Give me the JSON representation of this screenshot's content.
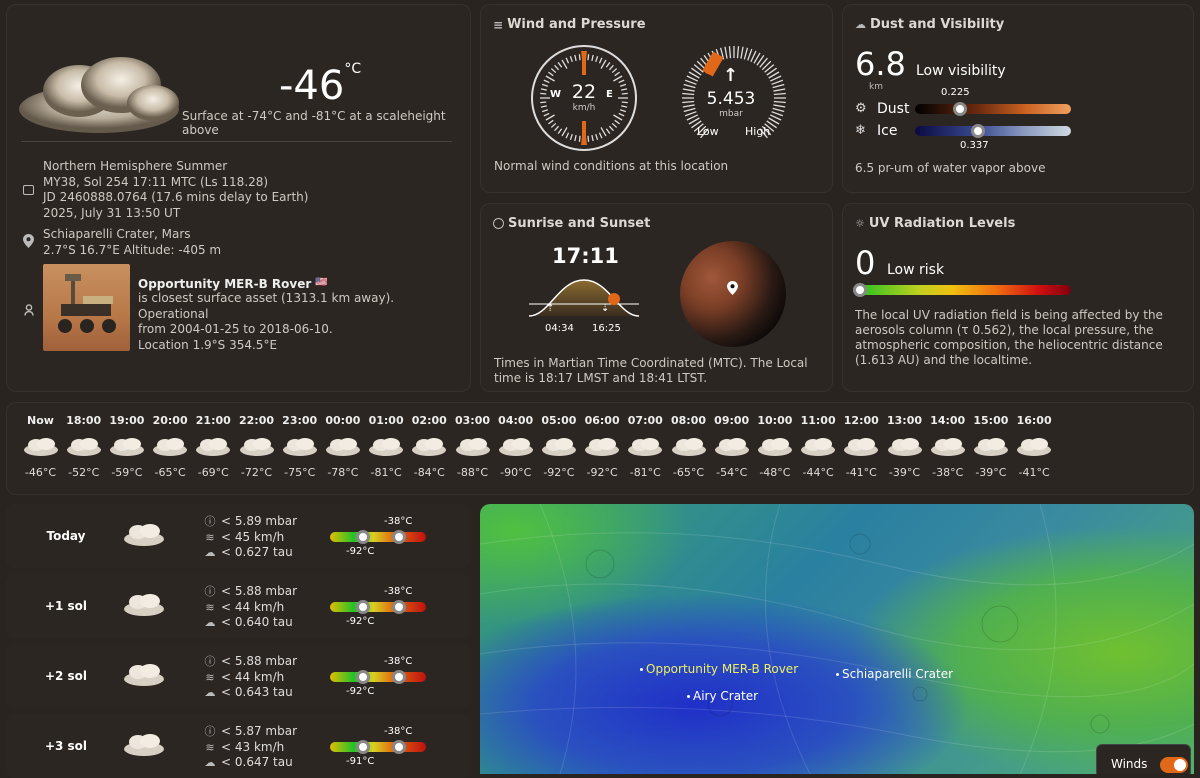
{
  "current": {
    "temp": "-46",
    "unit": "°C",
    "surface": "Surface at -74°C and -81°C at a scaleheight above",
    "date_lines": [
      "Northern Hemisphere Summer",
      "MY38, Sol 254 17:11 MTC (Ls 118.28)",
      "JD 2460888.0764 (17.6 mins delay to Earth)",
      "2025, July 31 13:50 UT"
    ],
    "location_lines": [
      "Schiaparelli Crater, Mars",
      "2.7°S 16.7°E Altitude: -405 m"
    ],
    "rover_name": "Opportunity MER-B Rover",
    "rover_flag": "🇺🇸",
    "rover_lines": [
      "is closest surface asset (1313.1 km away). Operational",
      "from 2004-01-25 to 2018-06-10.",
      "Location 1.9°S 354.5°E"
    ]
  },
  "wind": {
    "title": "Wind and Pressure",
    "speed": "22",
    "speed_unit": "km/h",
    "dirs": {
      "w": "W",
      "e": "E"
    },
    "pressure": "5.453",
    "pressure_unit": "mbar",
    "low": "Low",
    "high": "High",
    "note": "Normal wind conditions at this location"
  },
  "dust": {
    "title": "Dust and Visibility",
    "visibility": "6.8",
    "vis_unit": "km",
    "vis_label": "Low visibility",
    "dust_label": "Dust",
    "dust_value": "0.225",
    "dust_level": 0.225,
    "ice_label": "Ice",
    "ice_value": "0.337",
    "ice_level": 0.337,
    "note": "6.5 pr-um of water vapor above"
  },
  "sun": {
    "title": "Sunrise and Sunset",
    "time": "17:11",
    "sunrise": "04:34",
    "sunset": "16:25",
    "note": "Times in Martian Time Coordinated (MTC). The Local time is 18:17 LMST and 18:41 LTST."
  },
  "uv": {
    "title": "UV Radiation Levels",
    "value": "0",
    "label": "Low risk",
    "level": 0,
    "note": "The local UV radiation field is being affected by the aerosols column (τ 0.562), the local pressure, the atmospheric composition, the heliocentric distance (1.613 AU) and the localtime."
  },
  "hourly": [
    {
      "t": "Now",
      "v": "-46°C"
    },
    {
      "t": "18:00",
      "v": "-52°C"
    },
    {
      "t": "19:00",
      "v": "-59°C"
    },
    {
      "t": "20:00",
      "v": "-65°C"
    },
    {
      "t": "21:00",
      "v": "-69°C"
    },
    {
      "t": "22:00",
      "v": "-72°C"
    },
    {
      "t": "23:00",
      "v": "-75°C"
    },
    {
      "t": "00:00",
      "v": "-78°C"
    },
    {
      "t": "01:00",
      "v": "-81°C"
    },
    {
      "t": "02:00",
      "v": "-84°C"
    },
    {
      "t": "03:00",
      "v": "-88°C"
    },
    {
      "t": "04:00",
      "v": "-90°C"
    },
    {
      "t": "05:00",
      "v": "-92°C"
    },
    {
      "t": "06:00",
      "v": "-92°C"
    },
    {
      "t": "07:00",
      "v": "-81°C"
    },
    {
      "t": "08:00",
      "v": "-65°C"
    },
    {
      "t": "09:00",
      "v": "-54°C"
    },
    {
      "t": "10:00",
      "v": "-48°C"
    },
    {
      "t": "11:00",
      "v": "-44°C"
    },
    {
      "t": "12:00",
      "v": "-41°C"
    },
    {
      "t": "13:00",
      "v": "-39°C"
    },
    {
      "t": "14:00",
      "v": "-38°C"
    },
    {
      "t": "15:00",
      "v": "-39°C"
    },
    {
      "t": "16:00",
      "v": "-41°C"
    }
  ],
  "forecast": [
    {
      "label": "Today",
      "p": "< 5.89 mbar",
      "w": "< 45 km/h",
      "d": "< 0.627 tau",
      "hi": "-38°C",
      "lo": "-92°C"
    },
    {
      "label": "+1 sol",
      "p": "< 5.88 mbar",
      "w": "< 44 km/h",
      "d": "< 0.640 tau",
      "hi": "-38°C",
      "lo": "-92°C"
    },
    {
      "label": "+2 sol",
      "p": "< 5.88 mbar",
      "w": "< 44 km/h",
      "d": "< 0.643 tau",
      "hi": "-38°C",
      "lo": "-92°C"
    },
    {
      "label": "+3 sol",
      "p": "< 5.87 mbar",
      "w": "< 43 km/h",
      "d": "< 0.647 tau",
      "hi": "-38°C",
      "lo": "-91°C"
    }
  ],
  "map": {
    "labels": {
      "opportunity": "Opportunity MER-B Rover",
      "airy": "Airy Crater",
      "schiaparelli": "Schiaparelli Crater"
    },
    "toggle": "Winds",
    "toggle_on": true
  },
  "colors": {
    "accent": "#e06818",
    "card": "#2c2622",
    "text": "#e8e4df"
  }
}
